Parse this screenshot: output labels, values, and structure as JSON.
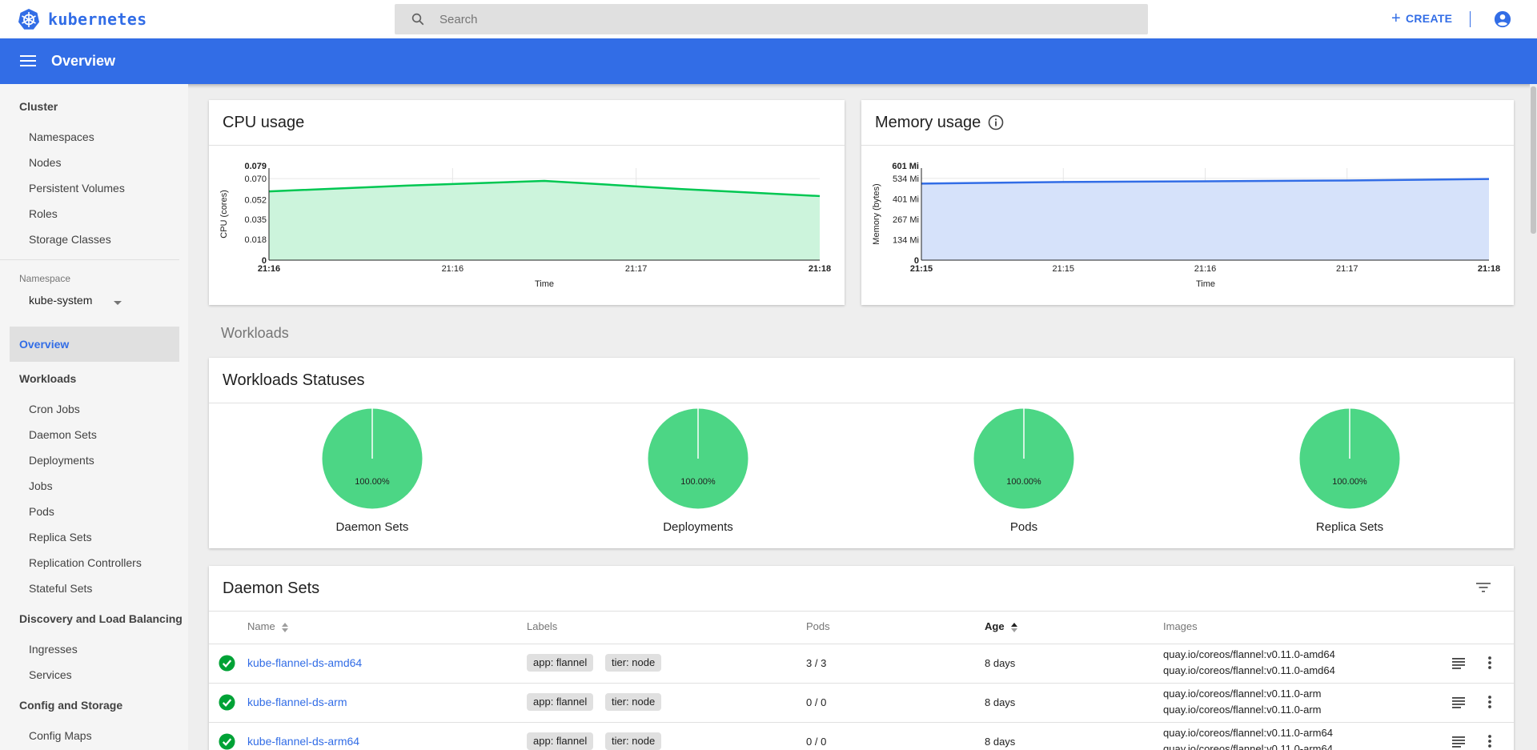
{
  "app": {
    "name": "kubernetes"
  },
  "topbar": {
    "search_placeholder": "Search",
    "create_label": "CREATE"
  },
  "toolbar": {
    "title": "Overview"
  },
  "sidebar": {
    "cluster": {
      "heading": "Cluster",
      "items": [
        "Namespaces",
        "Nodes",
        "Persistent Volumes",
        "Roles",
        "Storage Classes"
      ]
    },
    "namespace": {
      "label": "Namespace",
      "selected": "kube-system"
    },
    "overview_label": "Overview",
    "workloads": {
      "heading": "Workloads",
      "items": [
        "Cron Jobs",
        "Daemon Sets",
        "Deployments",
        "Jobs",
        "Pods",
        "Replica Sets",
        "Replication Controllers",
        "Stateful Sets"
      ]
    },
    "discovery": {
      "heading": "Discovery and Load Balancing",
      "items": [
        "Ingresses",
        "Services"
      ]
    },
    "config": {
      "heading": "Config and Storage",
      "items": [
        "Config Maps"
      ]
    }
  },
  "cpu_card": {
    "title": "CPU usage"
  },
  "memory_card": {
    "title": "Memory usage"
  },
  "workloads_section": {
    "title": "Workloads"
  },
  "statuses_card": {
    "title": "Workloads Statuses",
    "pies": [
      {
        "name": "Daemon Sets",
        "label": "100.00%",
        "running": 1.0
      },
      {
        "name": "Deployments",
        "label": "100.00%",
        "running": 1.0
      },
      {
        "name": "Pods",
        "label": "100.00%",
        "running": 1.0
      },
      {
        "name": "Replica Sets",
        "label": "100.00%",
        "running": 1.0
      }
    ]
  },
  "daemon_sets": {
    "title": "Daemon Sets",
    "columns": {
      "name": "Name",
      "labels": "Labels",
      "pods": "Pods",
      "age": "Age",
      "images": "Images"
    },
    "rows": [
      {
        "name": "kube-flannel-ds-amd64",
        "labels": [
          "app: flannel",
          "tier: node"
        ],
        "pods": "3 / 3",
        "age": "8 days",
        "images": [
          "quay.io/coreos/flannel:v0.11.0-amd64",
          "quay.io/coreos/flannel:v0.11.0-amd64"
        ]
      },
      {
        "name": "kube-flannel-ds-arm",
        "labels": [
          "app: flannel",
          "tier: node"
        ],
        "pods": "0 / 0",
        "age": "8 days",
        "images": [
          "quay.io/coreos/flannel:v0.11.0-arm",
          "quay.io/coreos/flannel:v0.11.0-arm"
        ]
      },
      {
        "name": "kube-flannel-ds-arm64",
        "labels": [
          "app: flannel",
          "tier: node"
        ],
        "pods": "0 / 0",
        "age": "8 days",
        "images": [
          "quay.io/coreos/flannel:v0.11.0-arm64",
          "quay.io/coreos/flannel:v0.11.0-arm64"
        ]
      }
    ]
  },
  "colors": {
    "brand": "#326de6",
    "cpu_line": "#00c752",
    "cpu_fill": "#ccf4dc",
    "mem_line": "#326de6",
    "mem_fill": "#d6e2fa",
    "pie": "#4cd685",
    "ok": "#00a236"
  },
  "chart_data": [
    {
      "type": "area",
      "ylabel": "CPU (cores)",
      "xlabel": "Time",
      "x": [
        "21:16",
        "21:16",
        "21:17",
        "21:18"
      ],
      "yticks": [
        0,
        0.018,
        0.035,
        0.052,
        0.07,
        0.079
      ],
      "ytick_labels": [
        "0",
        "0.018",
        "0.035",
        "0.052",
        "0.070",
        "0.079"
      ],
      "ylim": [
        0,
        0.079
      ],
      "points": [
        0.059,
        0.064,
        0.068,
        0.061,
        0.055
      ],
      "grid": true
    },
    {
      "type": "area",
      "ylabel": "Memory (bytes)",
      "xlabel": "Time",
      "x": [
        "21:15",
        "21:15",
        "21:16",
        "21:17",
        "21:18"
      ],
      "yticks": [
        0,
        134,
        267,
        401,
        534,
        601
      ],
      "ytick_labels": [
        "0",
        "134 Mi",
        "267 Mi",
        "401 Mi",
        "534 Mi",
        "601 Mi"
      ],
      "ylim": [
        0,
        601
      ],
      "points": [
        500,
        510,
        515,
        520,
        530
      ],
      "grid": true
    }
  ]
}
